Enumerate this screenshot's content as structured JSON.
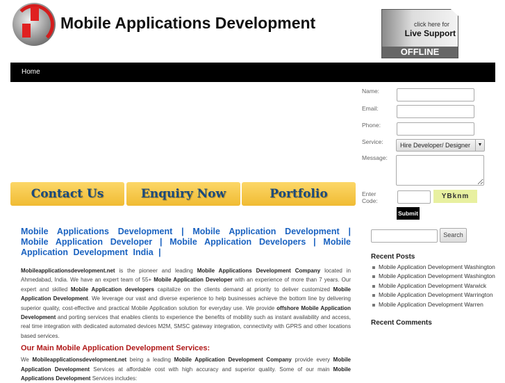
{
  "header": {
    "title": "Mobile Applications Development",
    "support": {
      "line1": "click here for",
      "line2": "Live Support",
      "status": "OFFLINE"
    }
  },
  "nav": {
    "home": "Home"
  },
  "banner_buttons": [
    "Contact Us",
    "Enquiry Now",
    "Portfolio"
  ],
  "main": {
    "headline": "Mobile Applications Development | Mobile Application Development | Mobile Application Developer | Mobile Application Developers | Mobile Application Development India |",
    "para1": [
      {
        "t": "Mobileapplicationsdevelopment.net",
        "b": true
      },
      {
        "t": " is the pioneer and leading "
      },
      {
        "t": "Mobile Applications Development Company",
        "b": true
      },
      {
        "t": " located in Ahmedabad, India. We have an expert team of 55+ "
      },
      {
        "t": "Mobile Application Developer",
        "b": true
      },
      {
        "t": " with an experience of more than 7 years. Our expert and skilled "
      },
      {
        "t": "Mobile Application developers",
        "b": true
      },
      {
        "t": " capitalize on the clients demand at priority to deliver customized "
      },
      {
        "t": "Mobile Application Development",
        "b": true
      },
      {
        "t": ". We leverage our vast and diverse experience to help businesses achieve the bottom line by delivering superior quality, cost-effective and practical Mobile Application solution for everyday use. We provide "
      },
      {
        "t": "offshore Mobile Application Development",
        "b": true
      },
      {
        "t": " and porting services that enables clients to experience the benefits of mobility such as instant availability and access, real time integration with dedicated automated devices M2M, SMSC gateway integration, connectivity with GPRS and other locations based services."
      }
    ],
    "services_heading": "Our Main Mobile Application Development Services:",
    "para2": [
      {
        "t": "We "
      },
      {
        "t": "Mobileapplicationsdevelopment.net",
        "b": true
      },
      {
        "t": " being a leading "
      },
      {
        "t": "Mobile Application Development Company",
        "b": true
      },
      {
        "t": " provide every "
      },
      {
        "t": "Mobile Application Development",
        "b": true
      },
      {
        "t": " Services at affordable cost with high accuracy and superior quality. Some of our main "
      },
      {
        "t": "Mobile Applications Development",
        "b": true
      },
      {
        "t": " Services includes:"
      }
    ]
  },
  "form": {
    "name_label": "Name:",
    "email_label": "Email:",
    "phone_label": "Phone:",
    "service_label": "Service:",
    "service_value": "Hire Developer/ Designer",
    "message_label": "Message:",
    "code_label": "Enter Code:",
    "captcha": "YBknm",
    "submit": "Submit"
  },
  "search": {
    "button": "Search"
  },
  "sidebar": {
    "recent_posts_title": "Recent Posts",
    "recent_posts": [
      "Mobile Application Development Washington",
      "Mobile Application Development Washington",
      "Mobile Application Development Warwick",
      "Mobile Application Development Warrington",
      "Mobile Application Development Warren"
    ],
    "recent_comments_title": "Recent Comments"
  }
}
